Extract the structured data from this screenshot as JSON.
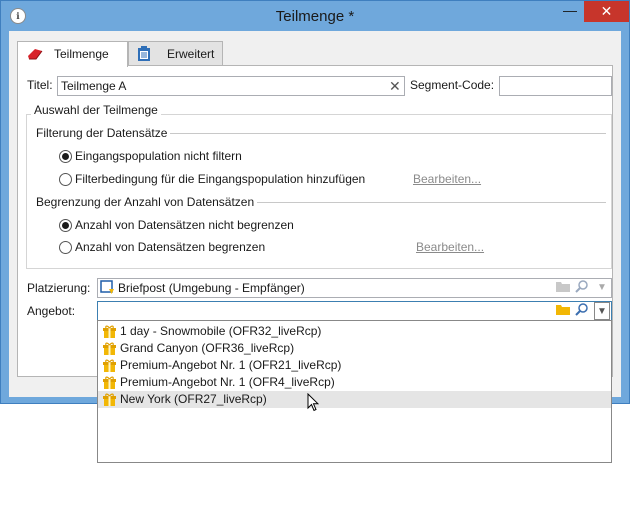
{
  "window": {
    "title": "Teilmenge *",
    "app_icon": "app-icon",
    "close_symbol": "✕",
    "minimize_symbol": "—"
  },
  "tabs": [
    {
      "label": "Teilmenge",
      "icon": "eraser-icon",
      "active": true
    },
    {
      "label": "Erweitert",
      "icon": "clipboard-icon",
      "active": false
    }
  ],
  "form": {
    "title_label": "Titel:",
    "title_value": "Teilmenge A",
    "segment_label": "Segment-Code:",
    "segment_value": "",
    "selection_group": "Auswahl der Teilmenge",
    "filter_section": "Filterung der Datensätze",
    "filter_opt1": "Eingangspopulation nicht filtern",
    "filter_opt2": "Filterbedingung für die Eingangspopulation hinzufügen",
    "filter_edit": "Bearbeiten...",
    "limit_section": "Begrenzung der Anzahl von Datensätzen",
    "limit_opt1": "Anzahl von Datensätzen nicht begrenzen",
    "limit_opt2": "Anzahl von Datensätzen begrenzen",
    "limit_edit": "Bearbeiten...",
    "placement_label": "Platzierung:",
    "placement_value": "Briefpost (Umgebung - Empfänger)",
    "offer_label": "Angebot:",
    "offer_value": ""
  },
  "offers": [
    "1 day - Snowmobile (OFR32_liveRcp)",
    "Grand Canyon (OFR36_liveRcp)",
    "Premium-Angebot Nr. 1 (OFR21_liveRcp)",
    "Premium-Angebot Nr. 1 (OFR4_liveRcp)",
    "New York (OFR27_liveRcp)"
  ],
  "colors": {
    "frame": "#6fa8dc",
    "close_button": "#c7352b",
    "gift_icon": "#f2b705"
  }
}
